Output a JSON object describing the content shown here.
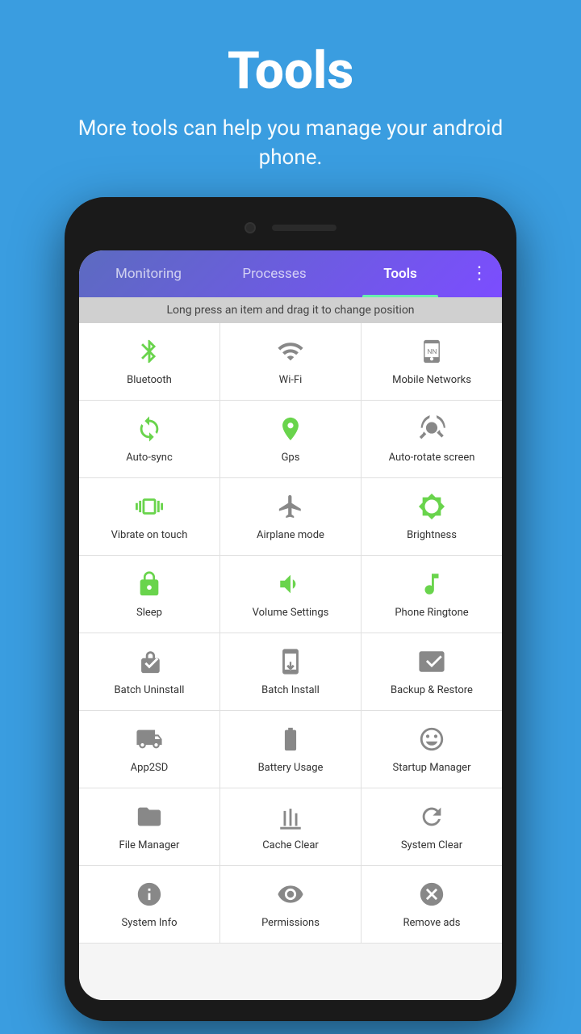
{
  "header": {
    "title": "Tools",
    "subtitle": "More tools can help you manage your android phone."
  },
  "tabs": [
    {
      "id": "monitoring",
      "label": "Monitoring",
      "active": false
    },
    {
      "id": "processes",
      "label": "Processes",
      "active": false
    },
    {
      "id": "tools",
      "label": "Tools",
      "active": true
    }
  ],
  "more_icon": "⋮",
  "hint": "Long press an item and drag it to change position",
  "grid": [
    [
      {
        "id": "bluetooth",
        "label": "Bluetooth",
        "iconType": "green"
      },
      {
        "id": "wifi",
        "label": "Wi-Fi",
        "iconType": "gray"
      },
      {
        "id": "mobile-networks",
        "label": "Mobile Networks",
        "iconType": "gray"
      }
    ],
    [
      {
        "id": "auto-sync",
        "label": "Auto-sync",
        "iconType": "green"
      },
      {
        "id": "gps",
        "label": "Gps",
        "iconType": "green"
      },
      {
        "id": "auto-rotate",
        "label": "Auto-rotate screen",
        "iconType": "gray"
      }
    ],
    [
      {
        "id": "vibrate",
        "label": "Vibrate on touch",
        "iconType": "green"
      },
      {
        "id": "airplane",
        "label": "Airplane mode",
        "iconType": "gray"
      },
      {
        "id": "brightness",
        "label": "Brightness",
        "iconType": "green"
      }
    ],
    [
      {
        "id": "sleep",
        "label": "Sleep",
        "iconType": "green"
      },
      {
        "id": "volume",
        "label": "Volume Settings",
        "iconType": "green"
      },
      {
        "id": "ringtone",
        "label": "Phone Ringtone",
        "iconType": "green"
      }
    ],
    [
      {
        "id": "batch-uninstall",
        "label": "Batch Uninstall",
        "iconType": "gray"
      },
      {
        "id": "batch-install",
        "label": "Batch Install",
        "iconType": "gray"
      },
      {
        "id": "backup",
        "label": "Backup & Restore",
        "iconType": "gray"
      }
    ],
    [
      {
        "id": "app2sd",
        "label": "App2SD",
        "iconType": "gray"
      },
      {
        "id": "battery",
        "label": "Battery Usage",
        "iconType": "gray"
      },
      {
        "id": "startup",
        "label": "Startup Manager",
        "iconType": "gray"
      }
    ],
    [
      {
        "id": "file-manager",
        "label": "File Manager",
        "iconType": "gray"
      },
      {
        "id": "cache-clear",
        "label": "Cache Clear",
        "iconType": "gray"
      },
      {
        "id": "system-clear",
        "label": "System Clear",
        "iconType": "gray"
      }
    ],
    [
      {
        "id": "system-info",
        "label": "System Info",
        "iconType": "gray"
      },
      {
        "id": "permissions",
        "label": "Permissions",
        "iconType": "gray"
      },
      {
        "id": "remove-ads",
        "label": "Remove ads",
        "iconType": "gray"
      }
    ]
  ]
}
